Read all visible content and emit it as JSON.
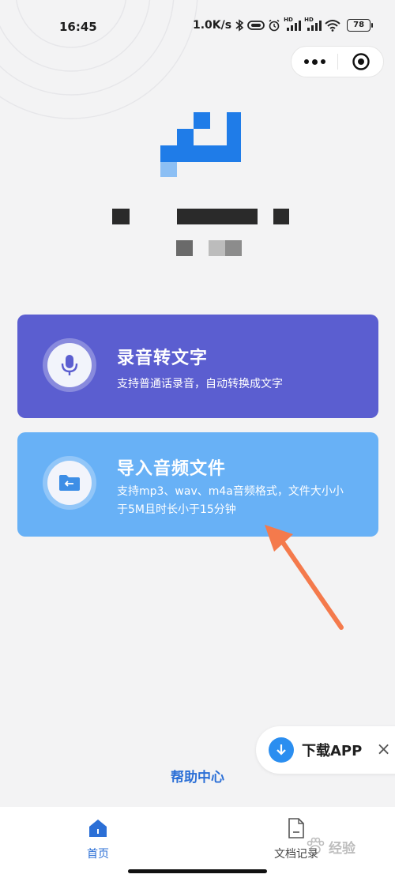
{
  "status_bar": {
    "time": "16:45",
    "net_speed": "1.0K/s",
    "battery": "78",
    "signal_tag_1": "HD",
    "signal_tag_2": "HD"
  },
  "capsule": {
    "more_icon": "more-dots-icon",
    "close_icon": "target-close-icon"
  },
  "cards": [
    {
      "title": "录音转文字",
      "desc": "支持普通话录音，自动转换成文字",
      "icon": "microphone-icon",
      "color": "#5b5ed0"
    },
    {
      "title": "导入音频文件",
      "desc": "支持mp3、wav、m4a音频格式，文件大小小于5M且时长小于15分钟",
      "icon": "folder-import-icon",
      "color": "#68b1f6"
    }
  ],
  "download_app": {
    "label": "下载APP",
    "close": "×"
  },
  "help_link": "帮助中心",
  "tab_bar": {
    "tabs": [
      {
        "label": "首页",
        "active": true,
        "icon": "home-icon"
      },
      {
        "label": "文档记录",
        "active": false,
        "icon": "document-icon"
      }
    ]
  },
  "watermark": {
    "text": "经验",
    "icon": "paw-icon"
  },
  "colors": {
    "accent": "#2b6fd6",
    "brand_blue": "#1f7ce8",
    "arrow_annotation": "#f47a4c"
  }
}
